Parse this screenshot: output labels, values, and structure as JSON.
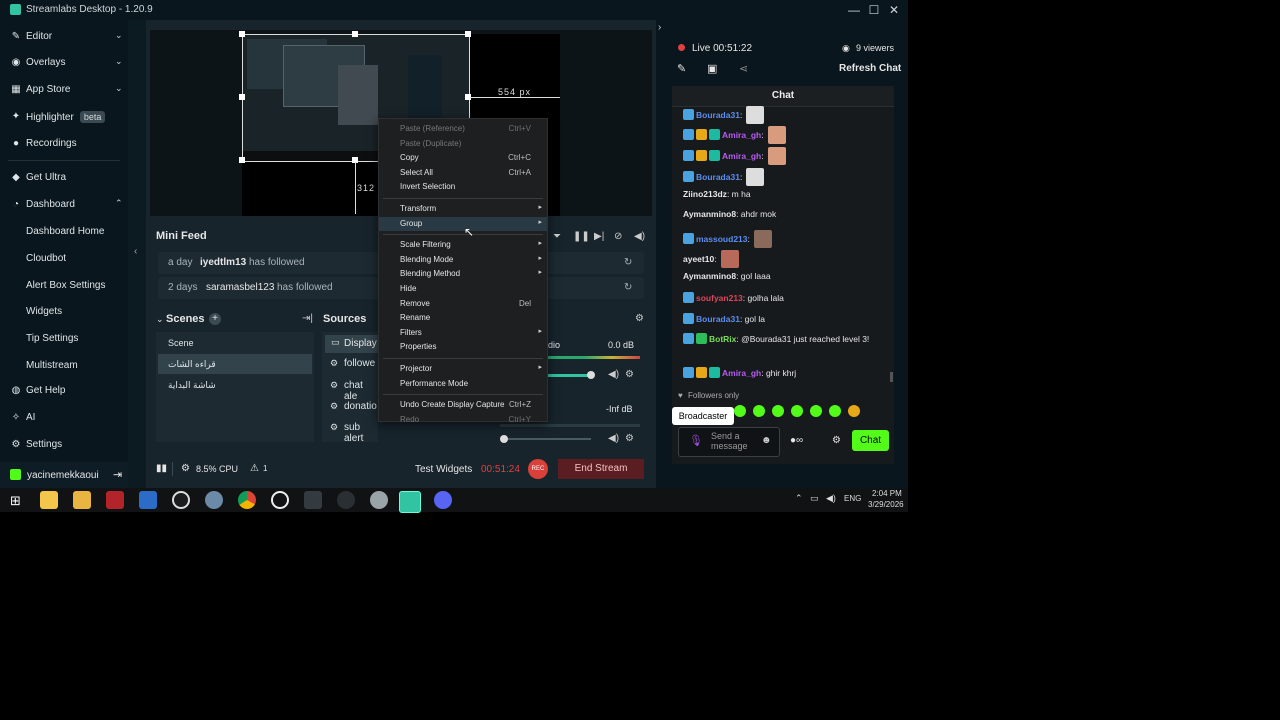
{
  "window": {
    "title": "Streamlabs Desktop - 1.20.9",
    "minimize": "—",
    "maximize": "☐",
    "close": "✕"
  },
  "sidebar": {
    "items": [
      {
        "icon": "✎",
        "label": "Editor",
        "chev": "⌄"
      },
      {
        "icon": "◉",
        "label": "Overlays",
        "chev": "⌄"
      },
      {
        "icon": "▦",
        "label": "App Store",
        "chev": "⌄"
      },
      {
        "icon": "✦",
        "label": "Highlighter",
        "badge": "beta"
      },
      {
        "icon": "●",
        "label": "Recordings"
      },
      {
        "icon": "◆",
        "label": "Get Ultra"
      },
      {
        "icon": "◔",
        "label": "Dashboard",
        "chev": "⌃"
      }
    ],
    "dashboard_sub": [
      "Dashboard Home",
      "Cloudbot",
      "Alert Box Settings",
      "Widgets",
      "Tip Settings",
      "Multistream"
    ],
    "bottom": [
      {
        "icon": "◍",
        "label": "Get Help"
      },
      {
        "icon": "✧",
        "label": "AI"
      },
      {
        "icon": "⚙",
        "label": "Settings"
      }
    ],
    "user": {
      "name": "yacinemekkaoui",
      "logout": "⇥"
    }
  },
  "preview": {
    "width_label": "554 px",
    "height_label": "312"
  },
  "minifeed": {
    "title": "Mini Feed",
    "rows": [
      {
        "time": "a day",
        "user": "iyedtlm13",
        "action": "has followed"
      },
      {
        "time": "2 days",
        "user": "saramasbel123",
        "action": "has followed"
      }
    ]
  },
  "scenes": {
    "title": "Scenes",
    "add": "+",
    "items": [
      "Scene",
      "قراءه الشات",
      "شاشة البداية"
    ]
  },
  "sources": {
    "title": "Sources",
    "items": [
      "Display",
      "followe",
      "chat ale",
      "donatio",
      "sub alert"
    ]
  },
  "mixer": {
    "item1_label": "dio",
    "item1_db": "0.0 dB",
    "item2_db": "-Inf dB"
  },
  "footer": {
    "cpu": "8.5% CPU",
    "alerts": "1",
    "test_widgets": "Test Widgets",
    "timer": "00:51:24",
    "rec": "REC",
    "end_stream": "End Stream"
  },
  "context_menu": {
    "items": [
      {
        "label": "Paste (Reference)",
        "shortcut": "Ctrl+V",
        "disabled": true
      },
      {
        "label": "Paste (Duplicate)",
        "disabled": true
      },
      {
        "label": "Copy",
        "shortcut": "Ctrl+C"
      },
      {
        "label": "Select All",
        "shortcut": "Ctrl+A"
      },
      {
        "label": "Invert Selection"
      },
      {
        "sep": true
      },
      {
        "label": "Transform",
        "arrow": "▸"
      },
      {
        "label": "Group",
        "arrow": "▸",
        "highlight": true
      },
      {
        "sep": true
      },
      {
        "label": "Scale Filtering",
        "arrow": "▸"
      },
      {
        "label": "Blending Mode",
        "arrow": "▸"
      },
      {
        "label": "Blending Method",
        "arrow": "▸"
      },
      {
        "label": "Hide"
      },
      {
        "label": "Remove",
        "shortcut": "Del"
      },
      {
        "label": "Rename"
      },
      {
        "label": "Filters",
        "arrow": "▸"
      },
      {
        "label": "Properties"
      },
      {
        "sep": true
      },
      {
        "label": "Projector",
        "arrow": "▸"
      },
      {
        "label": "Performance Mode"
      },
      {
        "sep": true
      },
      {
        "label": "Undo Create Display Capture",
        "shortcut": "Ctrl+Z"
      },
      {
        "label": "Redo",
        "shortcut": "Ctrl+Y",
        "disabled": true
      }
    ]
  },
  "stream": {
    "live_label": "Live 00:51:22",
    "viewers": "9 viewers",
    "refresh": "Refresh Chat"
  },
  "chat": {
    "title": "Chat",
    "messages": [
      {
        "user": "Bourada31",
        "color": "#5b8def",
        "text": ":",
        "badges": [
          "#4aa3df"
        ]
      },
      {
        "user": "Amira_gh",
        "color": "#b65bf0",
        "text": ":",
        "badges": [
          "#4aa3df",
          "#e6a817",
          "#1db9a0"
        ]
      },
      {
        "user": "Amira_gh",
        "color": "#b65bf0",
        "text": ":",
        "badges": [
          "#4aa3df",
          "#e6a817",
          "#1db9a0"
        ]
      },
      {
        "user": "Bourada31",
        "color": "#5b8def",
        "text": ":",
        "badges": [
          "#4aa3df"
        ]
      },
      {
        "user": "Ziino213dz",
        "color": "#e6e6e6",
        "text": ": m ha",
        "badges": []
      },
      {
        "user": "Aymanmino8",
        "color": "#e6e6e6",
        "text": ": ahdr mok",
        "badges": []
      },
      {
        "user": "massoud213",
        "color": "#5b8def",
        "text": ":",
        "badges": [
          "#4aa3df"
        ]
      },
      {
        "user": "ayeet10",
        "color": "#e6e6e6",
        "text": ":",
        "badges": []
      },
      {
        "user": "Aymanmino8",
        "color": "#e6e6e6",
        "text": ": gol laaa",
        "badges": []
      },
      {
        "user": "soufyan213",
        "color": "#e0455b",
        "text": ": golha lala",
        "badges": [
          "#4aa3df"
        ]
      },
      {
        "user": "Bourada31",
        "color": "#5b8def",
        "text": ": gol la",
        "badges": [
          "#4aa3df"
        ]
      },
      {
        "user": "BotRix",
        "color": "#7bdc5a",
        "text": ": @Bourada31 just reached level 3!",
        "badges": [
          "#4aa3df",
          "#2dbd5a"
        ]
      },
      {
        "user": "Amira_gh",
        "color": "#b65bf0",
        "text": ": ghir khrj",
        "badges": [
          "#4aa3df",
          "#e6a817",
          "#1db9a0"
        ]
      }
    ],
    "followers_only": "Followers only",
    "broadcaster": "Broadcaster",
    "input_placeholder": "Send a message",
    "send": "Chat"
  },
  "taskbar": {
    "time": "2:04 PM",
    "date": "3/29/2026",
    "lang": "ENG"
  },
  "colors": {
    "accent": "#31c3a2",
    "live": "#e04040",
    "chat_button": "#53fc18",
    "bg": "#09161d"
  }
}
